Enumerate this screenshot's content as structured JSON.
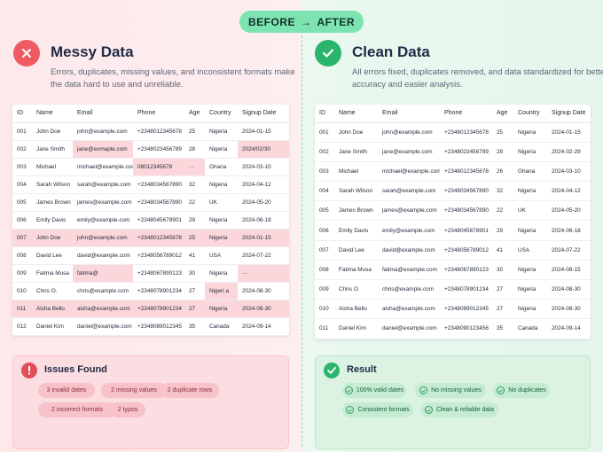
{
  "badge": {
    "before": "BEFORE",
    "arrow": "→",
    "after": "AFTER"
  },
  "messy": {
    "title": "Messy Data",
    "description": "Errors, duplicates, missing values, and inconsistent formats make the data hard to use and unreliable.",
    "columns": [
      "ID",
      "Name",
      "Email",
      "Phone",
      "Age",
      "Country",
      "Signup Date"
    ],
    "rows": [
      [
        "001",
        "John Doe",
        "john@example.com",
        "+2348012345678",
        "25",
        "Nigeria",
        "2024-01-15"
      ],
      [
        "002",
        "Jane Smith",
        "jane@exmaple.com",
        "+2348023456789",
        "28",
        "Nigeria",
        "2024/02/30"
      ],
      [
        "003",
        "Michael",
        "michael@example.com",
        "08012345678",
        "—",
        "Ghana",
        "2024-03-10"
      ],
      [
        "004",
        "Sarah Wilson",
        "sarah@example.com",
        "+2348034567890",
        "32",
        "Nigeria",
        "2024-04-12"
      ],
      [
        "005",
        "James Brown",
        "james@example.com",
        "+2348034567890",
        "22",
        "UK",
        "2024-05-20"
      ],
      [
        "006",
        "Emily Davis",
        "emily@example.com",
        "+2348045678901",
        "29",
        "Nigeria",
        "2024-06-18"
      ],
      [
        "007",
        "John Doe",
        "john@example.com",
        "+2348012345678",
        "25",
        "Nigeria",
        "2024-01-15"
      ],
      [
        "008",
        "David Lee",
        "david@example.com",
        "+2348056789012",
        "41",
        "USA",
        "2024-07-22"
      ],
      [
        "009",
        "Fatima Musa",
        "fatima@",
        "+2348067890123",
        "30",
        "Nigeria",
        "—"
      ],
      [
        "010",
        "Chris O.",
        "chris@example.com",
        "+2348078901234",
        "27",
        "Nigeri a",
        "2024-08-30"
      ],
      [
        "011",
        "Aisha Bello",
        "aisha@example.com",
        "+2348078901234",
        "27",
        "Nigeria",
        "2024-08-30"
      ],
      [
        "012",
        "Daniel Kim",
        "daniel@example.com",
        "+2348089012345",
        "35",
        "Canada",
        "2024-09-14"
      ]
    ]
  },
  "clean": {
    "title": "Clean Data",
    "description": "All errors fixed, duplicates removed, and data standardized for better accuracy and easier analysis.",
    "columns": [
      "ID",
      "Name",
      "Email",
      "Phone",
      "Age",
      "Country",
      "Signup Date"
    ],
    "rows": [
      [
        "001",
        "John Doe",
        "john@example.com",
        "+2348012345678",
        "25",
        "Nigeria",
        "2024-01-15"
      ],
      [
        "002",
        "Jane Smith",
        "jane@example.com",
        "+2348023456789",
        "28",
        "Nigeria",
        "2024-02-29"
      ],
      [
        "003",
        "Michael",
        "michael@example.com",
        "+2348012345678",
        "26",
        "Ghana",
        "2024-03-10"
      ],
      [
        "004",
        "Sarah Wilson",
        "sarah@example.com",
        "+2348034567890",
        "32",
        "Nigeria",
        "2024-04-12"
      ],
      [
        "005",
        "James Brown",
        "james@example.com",
        "+2348034567890",
        "22",
        "UK",
        "2024-05-20"
      ],
      [
        "006",
        "Emily Davis",
        "emily@example.com",
        "+2348045678901",
        "29",
        "Nigeria",
        "2024-06-18"
      ],
      [
        "007",
        "David Lee",
        "david@example.com",
        "+2348056789012",
        "41",
        "USA",
        "2024-07-22"
      ],
      [
        "008",
        "Fatima Musa",
        "fatima@example.com",
        "+2348067890123",
        "30",
        "Nigeria",
        "2024-08-15"
      ],
      [
        "009",
        "Chris O.",
        "chris@example.com",
        "+2348078901234",
        "27",
        "Nigeria",
        "2024-08-30"
      ],
      [
        "010",
        "Aisha Bello",
        "aisha@example.com",
        "+2348089012345",
        "27",
        "Nigeria",
        "2024-08-30"
      ],
      [
        "011",
        "Daniel Kim",
        "daniel@example.com",
        "+2348090123456",
        "35",
        "Canada",
        "2024-09-14"
      ]
    ]
  },
  "issues": {
    "title": "Issues Found",
    "pills": [
      "3 invalid dates",
      "2 missing values",
      "2 duplicate rows",
      "2 incorrect formats",
      "2 typos"
    ]
  },
  "result": {
    "title": "Result",
    "pills": [
      "100% valid dates",
      "No missing values",
      "No duplicates",
      "Consistent formats",
      "Clean & reliable data"
    ]
  },
  "colors": {
    "error_highlight": "#fbd7dc",
    "red_accent": "#ef5b63",
    "green_accent": "#2bb46b",
    "badge_bg": "#7de3b0"
  }
}
